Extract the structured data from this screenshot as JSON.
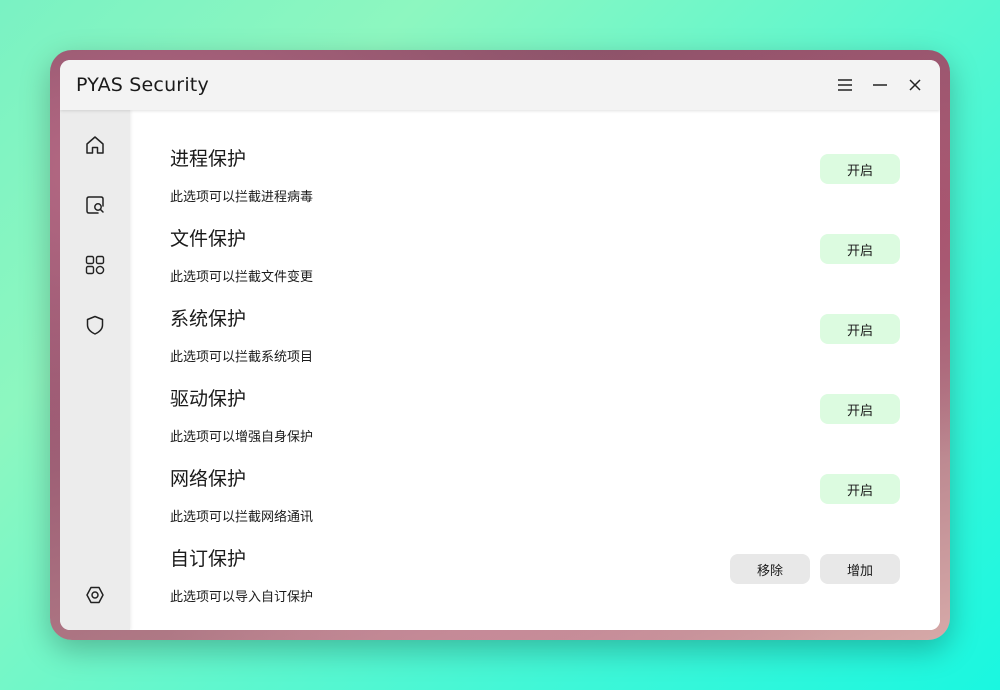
{
  "app": {
    "title": "PYAS Security"
  },
  "titlebar": {
    "menu_icon": "hamburger-menu-icon",
    "minimize_icon": "minimize-icon",
    "close_icon": "close-icon"
  },
  "sidebar": {
    "items": [
      {
        "icon": "home-icon"
      },
      {
        "icon": "scan-icon"
      },
      {
        "icon": "tools-icon"
      },
      {
        "icon": "shield-icon"
      }
    ],
    "settings_icon": "settings-icon"
  },
  "protections": [
    {
      "title": "进程保护",
      "desc": "此选项可以拦截进程病毒",
      "button": "开启"
    },
    {
      "title": "文件保护",
      "desc": "此选项可以拦截文件变更",
      "button": "开启"
    },
    {
      "title": "系统保护",
      "desc": "此选项可以拦截系统项目",
      "button": "开启"
    },
    {
      "title": "驱动保护",
      "desc": "此选项可以增强自身保护",
      "button": "开启"
    },
    {
      "title": "网络保护",
      "desc": "此选项可以拦截网络通讯",
      "button": "开启"
    },
    {
      "title": "自订保护",
      "desc": "此选项可以导入自订保护",
      "remove_button": "移除",
      "add_button": "增加"
    }
  ],
  "colors": {
    "enabled_button_bg": "#dcfbe0",
    "neutral_button_bg": "#e8e8e8"
  }
}
